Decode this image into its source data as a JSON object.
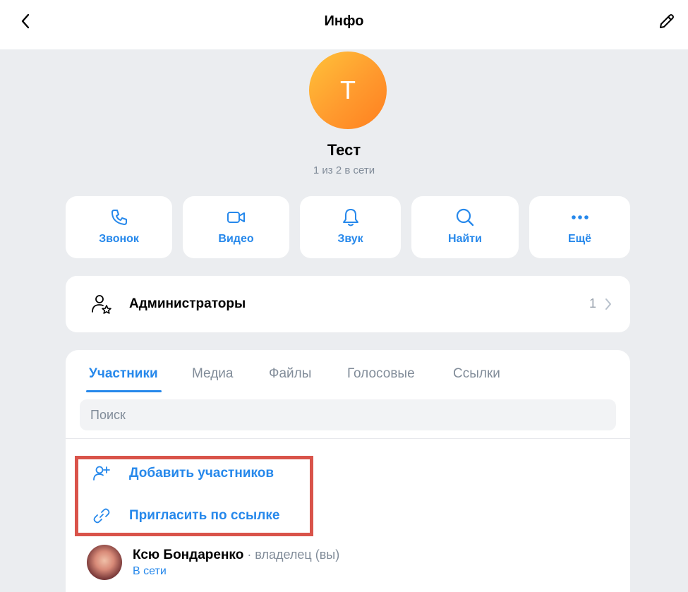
{
  "header": {
    "title": "Инфо",
    "back_icon": "chevron-left-icon",
    "edit_icon": "pencil-icon"
  },
  "chat": {
    "avatar_letter": "Т",
    "name": "Тест",
    "status": "1 из 2 в сети",
    "avatar_gradient": [
      "#ffc23a",
      "#ff7f1f"
    ]
  },
  "actions": [
    {
      "label": "Звонок",
      "icon": "phone-icon"
    },
    {
      "label": "Видео",
      "icon": "video-camera-icon"
    },
    {
      "label": "Звук",
      "icon": "bell-icon"
    },
    {
      "label": "Найти",
      "icon": "search-icon"
    },
    {
      "label": "Ещё",
      "icon": "more-dots-icon"
    }
  ],
  "admins": {
    "label": "Администраторы",
    "count": "1",
    "icon": "user-star-icon"
  },
  "tabs": [
    {
      "label": "Участники",
      "active": true
    },
    {
      "label": "Медиа",
      "active": false
    },
    {
      "label": "Файлы",
      "active": false
    },
    {
      "label": "Голосовые",
      "active": false
    },
    {
      "label": "Ссылки",
      "active": false
    }
  ],
  "search": {
    "placeholder": "Поиск",
    "value": ""
  },
  "member_actions": [
    {
      "label": "Добавить участников",
      "icon": "user-add-icon"
    },
    {
      "label": "Пригласить по ссылке",
      "icon": "link-icon"
    }
  ],
  "members": [
    {
      "name": "Ксю Бондаренко",
      "role": " · владелец (вы)",
      "status": "В сети"
    }
  ],
  "colors": {
    "accent": "#2688eb",
    "background": "#ebedf0",
    "secondary_text": "#818c99",
    "highlight": "#d9534a"
  }
}
